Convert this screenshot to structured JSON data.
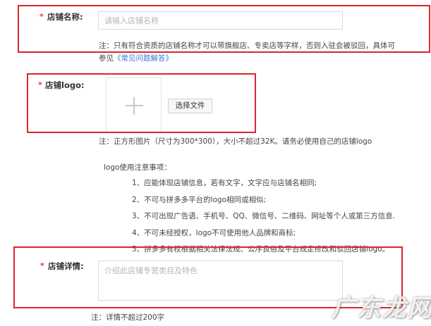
{
  "store_name": {
    "required_mark": "*",
    "label": "店铺名称:",
    "placeholder": "请输入店铺名称",
    "value": "",
    "note_line1": "注：只有符合资质的店铺名称才可以带旗舰店、专卖店等字样，否则入驻会被驳回，具体可",
    "note_line2_prefix": "参见",
    "note_link": "《常见问题解答》"
  },
  "store_logo": {
    "required_mark": "*",
    "label": "店铺logo:",
    "upload_plus": "+",
    "choose_file_label": "选择文件",
    "note": "注：正方形图片（尺寸为300*300），大小不超过32K。请务必使用自己的店铺logo",
    "rules_title": "logo使用注意事项：",
    "rules": [
      "1、应能体现店铺信息，若有文字，文字应与店铺名相同;",
      "2、不可与拼多多平台的logo相同或相似;",
      "3、不可出现广告语、手机号、QQ、微信号、二维码、网址等个人或第三方信息.",
      "4、不可未经授权，logo不可使用他人品牌和商标;",
      "5、拼多多有权根据相关法律法规、公序良俗及平台规定修改和驳回店铺logo。"
    ]
  },
  "store_detail": {
    "required_mark": "*",
    "label": "店铺详情:",
    "placeholder": "介绍此店铺专营类目及特色",
    "value": "",
    "note": "注：详情不超过200字"
  },
  "watermark": "广东龙网",
  "colors": {
    "required": "#e4393c",
    "highlight_box": "#d9262c",
    "link": "#3d7bd6"
  }
}
